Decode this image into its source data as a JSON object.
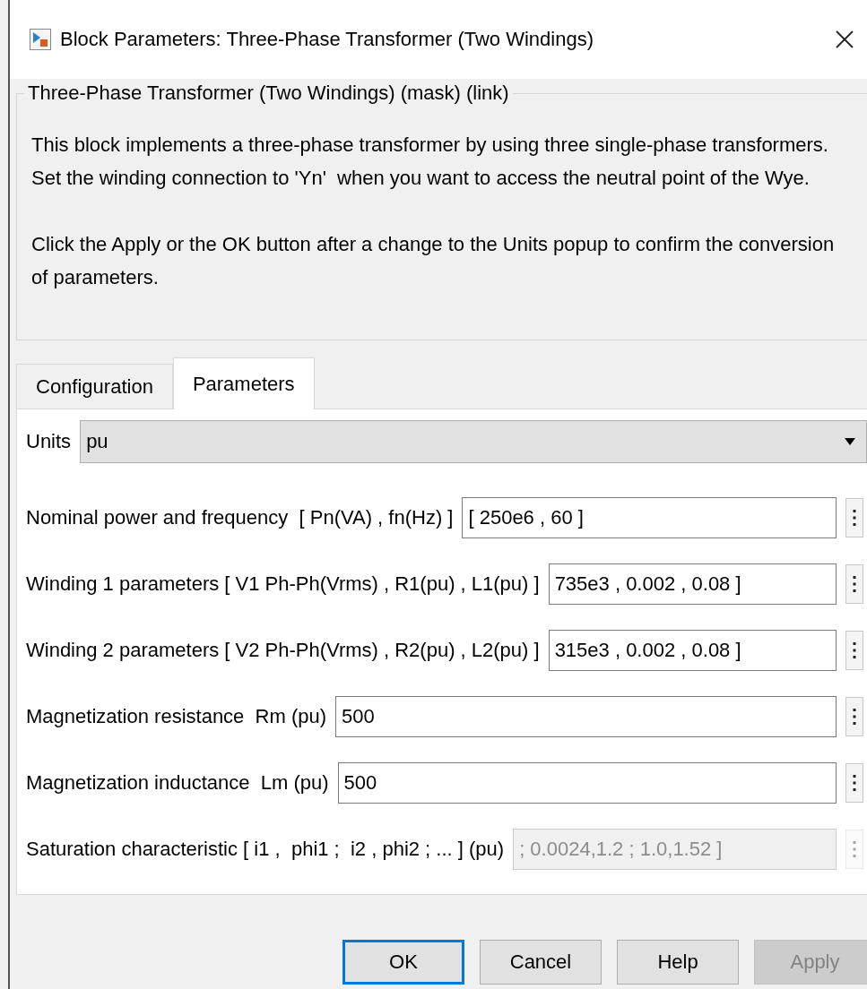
{
  "window": {
    "title": "Block Parameters: Three-Phase Transformer (Two Windings)"
  },
  "group": {
    "title": "Three-Phase Transformer (Two Windings) (mask) (link)",
    "paragraphs": [
      "This block implements a three-phase transformer by using three single-phase transformers. Set the winding connection to 'Yn'  when you want to access the neutral point of the Wye.",
      "Click the Apply or the OK button after a change to the Units popup to confirm the conversion of parameters."
    ]
  },
  "tabs": [
    {
      "label": "Configuration",
      "selected": false
    },
    {
      "label": "Parameters",
      "selected": true
    }
  ],
  "parameters": [
    {
      "kind": "dropdown",
      "label": "Units",
      "value": "pu",
      "disabled": false
    },
    {
      "kind": "edit",
      "label": "Nominal power and frequency  [ Pn(VA) , fn(Hz) ]",
      "value": "[ 250e6 , 60 ]",
      "disabled": false
    },
    {
      "kind": "edit",
      "label": "Winding 1 parameters [ V1 Ph-Ph(Vrms) , R1(pu) , L1(pu) ]",
      "value": "735e3 , 0.002 , 0.08 ]",
      "disabled": false
    },
    {
      "kind": "edit",
      "label": "Winding 2 parameters [ V2 Ph-Ph(Vrms) , R2(pu) , L2(pu) ]",
      "value": "315e3 , 0.002 , 0.08 ]",
      "disabled": false
    },
    {
      "kind": "edit",
      "label": "Magnetization resistance  Rm (pu)",
      "value": "500",
      "disabled": false
    },
    {
      "kind": "edit",
      "label": "Magnetization inductance  Lm (pu)",
      "value": "500",
      "disabled": false
    },
    {
      "kind": "edit",
      "label": "Saturation characteristic [ i1 ,  phi1 ;  i2 , phi2 ; ... ] (pu)",
      "value": "; 0.0024,1.2 ; 1.0,1.52 ]",
      "disabled": true
    }
  ],
  "buttons": [
    {
      "label": "OK",
      "default": true,
      "disabled": false
    },
    {
      "label": "Cancel",
      "default": false,
      "disabled": false
    },
    {
      "label": "Help",
      "default": false,
      "disabled": false
    },
    {
      "label": "Apply",
      "default": false,
      "disabled": true
    }
  ]
}
